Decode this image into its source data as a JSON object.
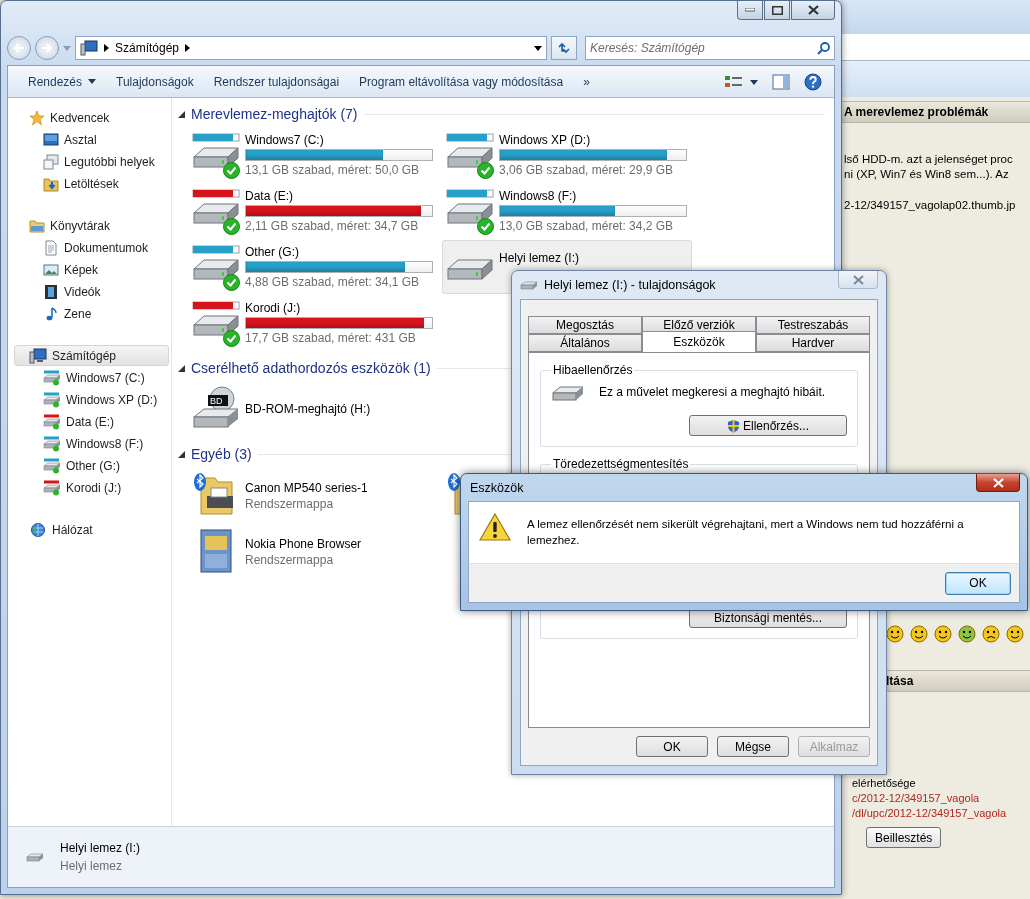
{
  "explorer": {
    "address": {
      "crumbs": [
        "Számítógép"
      ]
    },
    "search": {
      "placeholder": "Keresés: Számítógép"
    },
    "toolbar": [
      {
        "label": "Rendezés",
        "kind": "menu"
      },
      {
        "label": "Tulajdonságok",
        "kind": "command"
      },
      {
        "label": "Rendszer tulajdonságai",
        "kind": "command"
      },
      {
        "label": "Program eltávolítása vagy módosítása",
        "kind": "command"
      },
      {
        "label": "»",
        "kind": "more"
      }
    ],
    "sidebar": [
      {
        "label": "Kedvencek",
        "kind": "star",
        "selected": false,
        "children": [
          {
            "label": "Asztal",
            "kind": "desktop",
            "selected": false
          },
          {
            "label": "Legutóbbi helyek",
            "kind": "recent",
            "selected": false
          },
          {
            "label": "Letöltések",
            "kind": "downloads",
            "selected": false
          }
        ]
      },
      {
        "label": "Könyvtárak",
        "kind": "library",
        "selected": false,
        "children": [
          {
            "label": "Dokumentumok",
            "kind": "documents",
            "selected": false
          },
          {
            "label": "Képek",
            "kind": "pictures",
            "selected": false
          },
          {
            "label": "Videók",
            "kind": "videos",
            "selected": false
          },
          {
            "label": "Zene",
            "kind": "music",
            "selected": false
          }
        ]
      },
      {
        "label": "Számítógép",
        "kind": "computer",
        "selected": true,
        "children": [
          {
            "label": "Windows7 (C:)",
            "kind": "drive",
            "selected": false,
            "color": "#26a0c8"
          },
          {
            "label": "Windows XP (D:)",
            "kind": "drive",
            "selected": false,
            "color": "#26a0c8"
          },
          {
            "label": "Data (E:)",
            "kind": "drive",
            "selected": false,
            "color": "#d9131c"
          },
          {
            "label": "Windows8 (F:)",
            "kind": "drive",
            "selected": false,
            "color": "#26a0c8"
          },
          {
            "label": "Other (G:)",
            "kind": "drive",
            "selected": false,
            "color": "#26a0c8"
          },
          {
            "label": "Korodi (J:)",
            "kind": "drive",
            "selected": false,
            "color": "#d9131c"
          }
        ]
      },
      {
        "label": "Hálózat",
        "kind": "network",
        "selected": false
      }
    ],
    "sections": [
      {
        "title": "Merevlemez-meghajtók (7)",
        "items": [
          {
            "kind": "disk",
            "name": "Windows7 (C:)",
            "free": "13,1 GB szabad, méret: 50,0 GB",
            "level": 0.738,
            "color": "#26a0c8",
            "checked": true,
            "selected": false
          },
          {
            "kind": "disk",
            "name": "Windows XP (D:)",
            "free": "3,06 GB szabad, méret: 29,9 GB",
            "level": 0.898,
            "color": "#26a0c8",
            "checked": true,
            "selected": false
          },
          {
            "kind": "disk",
            "name": "Data (E:)",
            "free": "2,11 GB szabad, méret: 34,7 GB",
            "level": 0.939,
            "color": "#d9131c",
            "checked": true,
            "selected": false
          },
          {
            "kind": "disk",
            "name": "Windows8 (F:)",
            "free": "13,0 GB szabad, méret: 34,2 GB",
            "level": 0.62,
            "color": "#26a0c8",
            "checked": true,
            "selected": false
          },
          {
            "kind": "disk",
            "name": "Other (G:)",
            "free": "4,88 GB szabad, méret: 34,1 GB",
            "level": 0.857,
            "color": "#26a0c8",
            "checked": true,
            "selected": false
          },
          {
            "kind": "disk",
            "name": "Helyi lemez (I:)",
            "checked": false,
            "selected": true
          },
          {
            "kind": "disk",
            "name": "Korodi (J:)",
            "free": "17,7 GB szabad, méret: 431 GB",
            "level": 0.959,
            "color": "#d9131c",
            "checked": true,
            "selected": false
          }
        ]
      },
      {
        "title": "Cserélhető adathordozós eszközök (1)",
        "items": [
          {
            "kind": "optical",
            "name": "BD-ROM-meghajtó (H:)",
            "badge": "BD",
            "selected": false
          }
        ]
      },
      {
        "title": "Egyéb (3)",
        "items": [
          {
            "kind": "printer",
            "name": "Canon MP540 series-1",
            "subtitle": "Rendszermappa",
            "selected": false
          },
          {
            "kind": "folder",
            "selected": false
          },
          {
            "kind": "cabinet",
            "name": "Nokia Phone Browser",
            "subtitle": "Rendszermappa",
            "selected": false
          }
        ]
      }
    ],
    "details": {
      "title": "Helyi lemez (I:)",
      "subtitle": "Helyi lemez"
    }
  },
  "properties": {
    "title": "Helyi lemez (I:) - tulajdonságok",
    "tab_rows": [
      [
        {
          "label": "Megosztás",
          "selected": false
        },
        {
          "label": "Előző verziók",
          "selected": false
        },
        {
          "label": "Testreszabás",
          "selected": false
        }
      ],
      [
        {
          "label": "Általános",
          "selected": false
        },
        {
          "label": "Eszközök",
          "selected": true
        },
        {
          "label": "Hardver",
          "selected": false
        }
      ]
    ],
    "groups": [
      {
        "title": "Hibaellenőrzés",
        "text": "Ez a művelet megkeresi a meghajtó hibáit.",
        "button": "Ellenőrzés...",
        "shield": true
      },
      {
        "title": "Töredezettségmentesítés"
      },
      {
        "button": "Biztonsági mentés..."
      }
    ],
    "buttons": [
      {
        "label": "OK",
        "disabled": false
      },
      {
        "label": "Mégse",
        "disabled": false
      },
      {
        "label": "Alkalmaz",
        "disabled": true
      }
    ]
  },
  "message": {
    "title": "Eszközök",
    "text": "A lemez ellenőrzését nem sikerült végrehajtani, mert a Windows nem tud hozzáférni a lemezhez.",
    "button": "OK"
  },
  "browser": {
    "heading": "A merevlemez problémák",
    "post_lines": [
      "lső HDD-m. azt a jelenséget proc",
      "ni (XP, Win7 és Win8 sem...). Az"
    ],
    "attachment": "2-12/349157_vagolap02.thumb.jp",
    "section": "ltása",
    "lines": [
      {
        "text": "elérhetősége",
        "kind": "text"
      },
      {
        "text": "c/2012-12/349157_vagola",
        "kind": "link"
      },
      {
        "text": "/dl/upc/2012-12/349157_vagola",
        "kind": "link"
      }
    ],
    "button": "Beillesztés"
  }
}
